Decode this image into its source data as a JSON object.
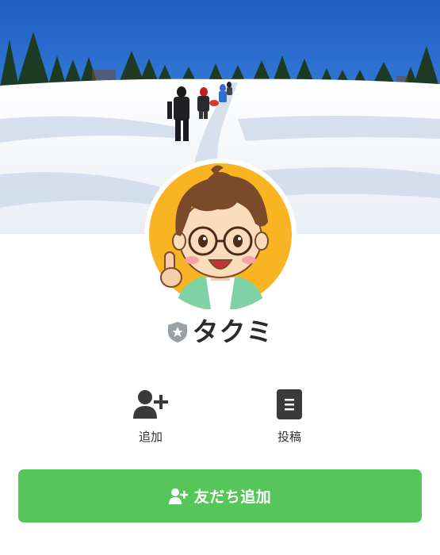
{
  "profile": {
    "name": "タクミ"
  },
  "actions": [
    {
      "label": "追加",
      "icon": "add-user-icon"
    },
    {
      "label": "投稿",
      "icon": "post-icon"
    }
  ],
  "add_friend_button": {
    "label": "友だち追加",
    "icon": "add-user-icon"
  },
  "colors": {
    "accent_green": "#57c65a",
    "avatar_background": "#f8b422",
    "name_text": "#2b2b2b",
    "icon_dark": "#3a3a3a"
  }
}
